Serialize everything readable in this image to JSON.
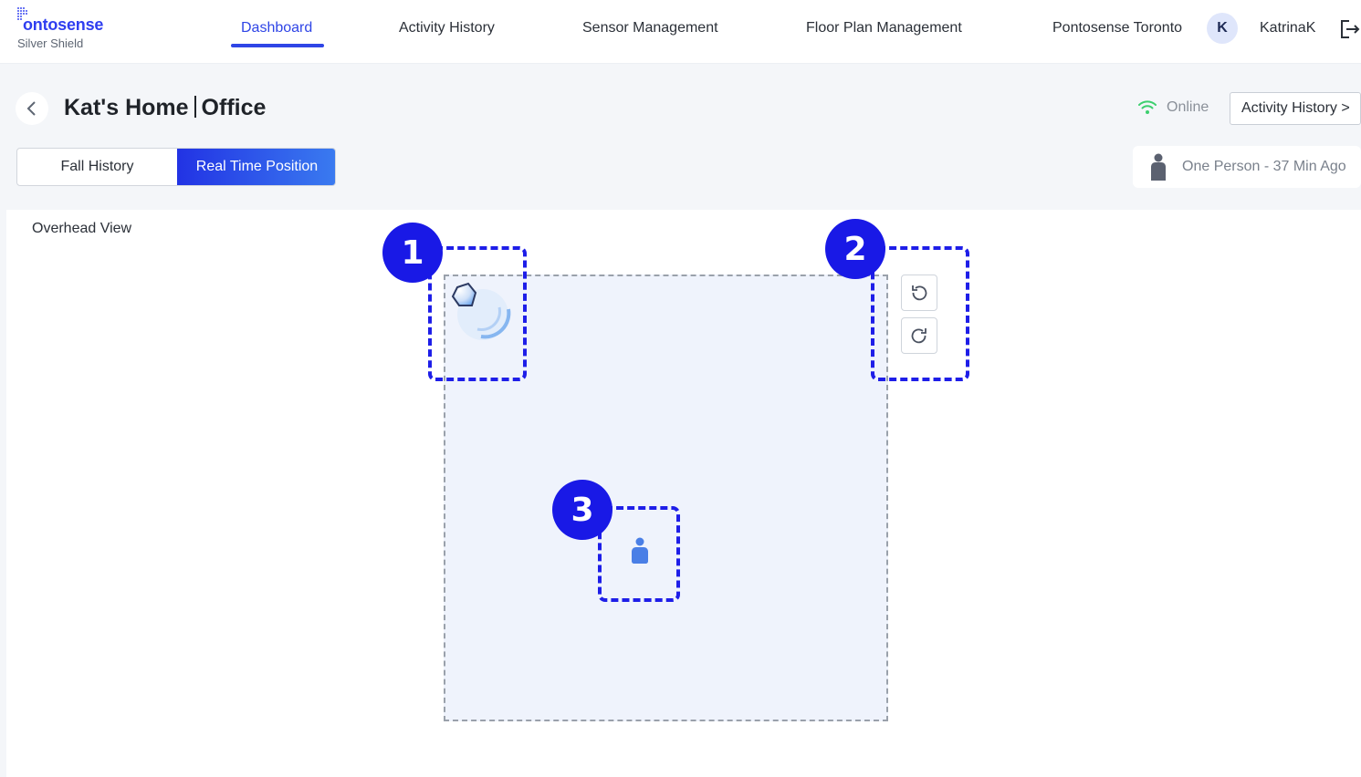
{
  "brand": {
    "name": "ontosense",
    "initial": "P",
    "subtitle": "Silver Shield"
  },
  "nav": {
    "tabs": [
      {
        "label": "Dashboard",
        "active": true
      },
      {
        "label": "Activity History"
      },
      {
        "label": "Sensor Management"
      },
      {
        "label": "Floor Plan Management"
      }
    ],
    "org": "Pontosense Toronto",
    "avatar_initial": "K",
    "username": "KatrinaK"
  },
  "header": {
    "title_home": "Kat's Home",
    "title_room": "Office",
    "status": "Online",
    "activity_button": "Activity History >"
  },
  "segment": {
    "options": [
      "Fall History",
      "Real Time Position"
    ],
    "selected": "Real Time Position"
  },
  "occupancy": {
    "text": "One Person - 37 Min Ago"
  },
  "panel": {
    "title": "Overhead View"
  },
  "callouts": [
    "1",
    "2",
    "3"
  ],
  "colors": {
    "accent": "#2f45e6",
    "callout": "#1919e6",
    "online": "#3ccf6e",
    "room": "#eff3fc"
  },
  "icons": [
    "back-chevron-icon",
    "wifi-icon",
    "person-icon",
    "rotate-left-icon",
    "rotate-right-icon",
    "logout-icon",
    "sensor-icon"
  ]
}
